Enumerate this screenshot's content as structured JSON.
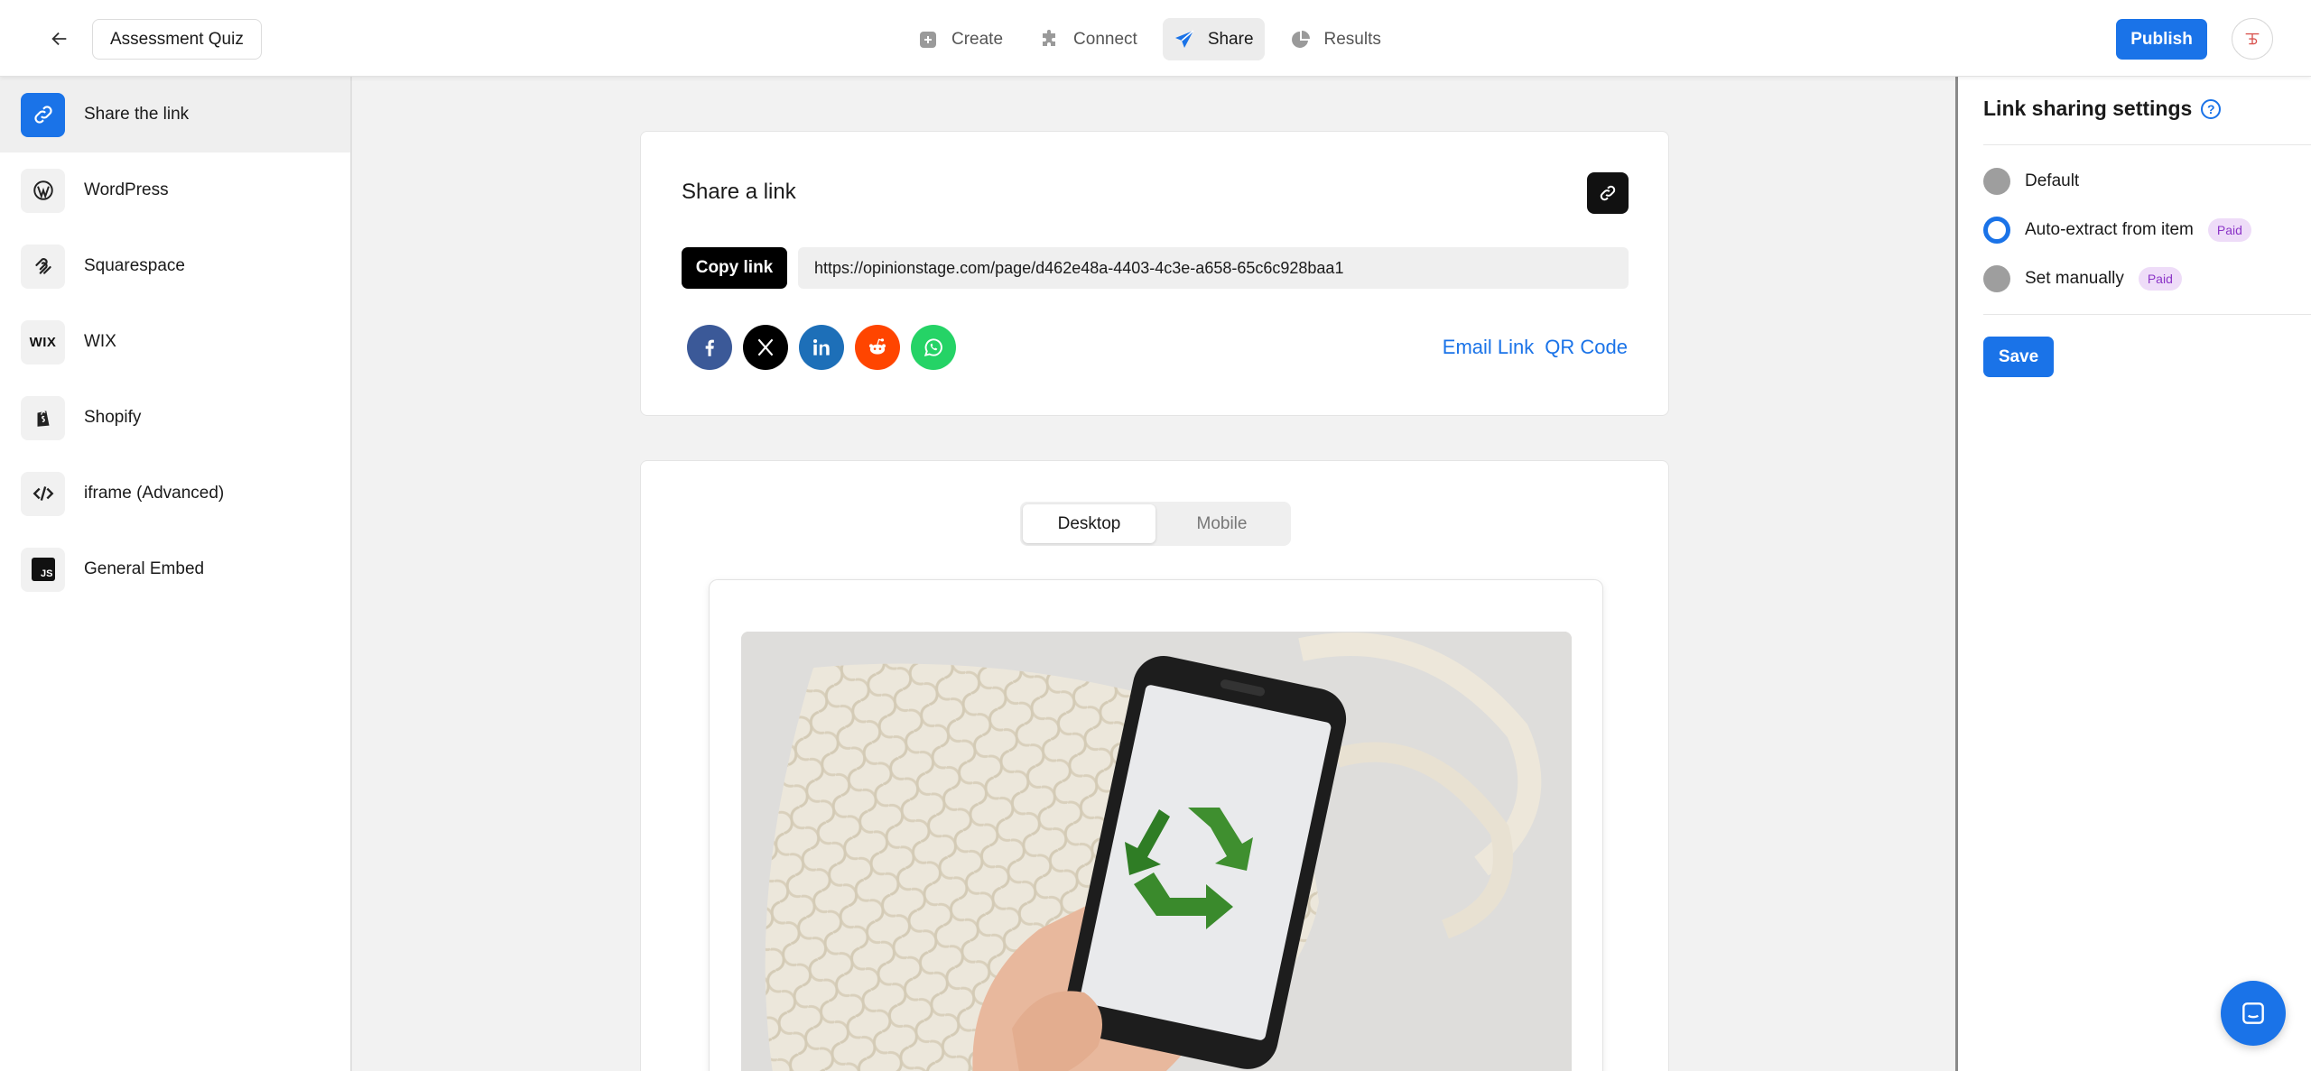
{
  "header": {
    "title": "Assessment Quiz",
    "nav": [
      {
        "label": "Create",
        "icon": "plus-square-icon"
      },
      {
        "label": "Connect",
        "icon": "puzzle-icon"
      },
      {
        "label": "Share",
        "icon": "paper-plane-icon",
        "active": true
      },
      {
        "label": "Results",
        "icon": "pie-chart-icon"
      }
    ],
    "publish_label": "Publish"
  },
  "sidebar": {
    "items": [
      {
        "label": "Share the link",
        "icon": "link-icon",
        "active": true
      },
      {
        "label": "WordPress",
        "icon": "wordpress-icon"
      },
      {
        "label": "Squarespace",
        "icon": "squarespace-icon"
      },
      {
        "label": "WIX",
        "icon": "wix-icon",
        "icon_text": "WIX"
      },
      {
        "label": "Shopify",
        "icon": "shopify-icon"
      },
      {
        "label": "iframe (Advanced)",
        "icon": "code-icon"
      },
      {
        "label": "General Embed",
        "icon": "js-icon",
        "icon_text": "JS"
      }
    ]
  },
  "share": {
    "title": "Share a link",
    "copy_label": "Copy link",
    "url": "https://opinionstage.com/page/d462e48a-4403-4c3e-a658-65c6c928baa1",
    "socials": [
      "facebook-icon",
      "x-icon",
      "linkedin-icon",
      "reddit-icon",
      "whatsapp-icon"
    ],
    "email_link": "Email Link",
    "qr_code": "QR Code"
  },
  "preview": {
    "tabs": [
      {
        "label": "Desktop",
        "active": true
      },
      {
        "label": "Mobile"
      }
    ]
  },
  "settings": {
    "title": "Link sharing settings",
    "options": [
      {
        "label": "Default",
        "selected": false,
        "badge": ""
      },
      {
        "label": "Auto-extract from item",
        "selected": true,
        "badge": "Paid"
      },
      {
        "label": "Set manually",
        "selected": false,
        "badge": "Paid"
      }
    ],
    "save_label": "Save"
  },
  "colors": {
    "accent": "#1a73e8",
    "paid_bg": "#eedcf8",
    "paid_text": "#8b34c7"
  }
}
